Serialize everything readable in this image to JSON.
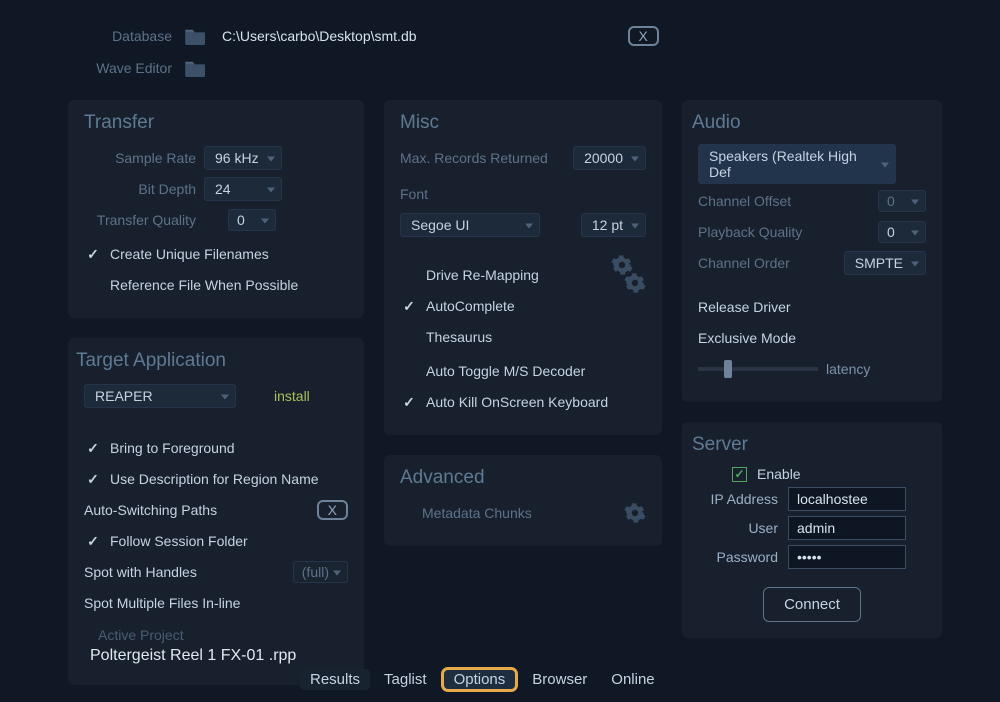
{
  "top": {
    "database_label": "Database",
    "database_path": "C:\\Users\\carbo\\Desktop\\smt.db",
    "wave_editor_label": "Wave Editor",
    "key_x": "X"
  },
  "transfer": {
    "title": "Transfer",
    "sample_rate_label": "Sample Rate",
    "sample_rate": "96 kHz",
    "bit_depth_label": "Bit Depth",
    "bit_depth": "24",
    "quality_label": "Transfer  Quality",
    "quality": "0",
    "create_unique": "Create Unique Filenames",
    "reference_file": "Reference File When Possible"
  },
  "target": {
    "title": "Target Application",
    "app": "REAPER",
    "install": "install",
    "bring_fg": "Bring to Foreground",
    "use_desc": "Use Description for Region Name",
    "auto_switch": "Auto-Switching Paths",
    "auto_switch_key": "X",
    "follow_session": "Follow Session Folder",
    "spot_handles": "Spot with Handles",
    "spot_handles_val": "(full)",
    "spot_multi": "Spot Multiple Files In-line",
    "active_project_label": "Active Project",
    "active_project": "Poltergeist Reel 1 FX-01 .rpp"
  },
  "misc": {
    "title": "Misc",
    "max_records_label": "Max. Records Returned",
    "max_records": "20000",
    "font_label": "Font",
    "font_name": "Segoe UI",
    "font_size": "12 pt",
    "drive_remap": "Drive Re-Mapping",
    "autocomplete": "AutoComplete",
    "thesaurus": "Thesaurus",
    "auto_toggle_ms": "Auto Toggle M/S Decoder",
    "auto_kill_kb": "Auto Kill OnScreen Keyboard"
  },
  "advanced": {
    "title": "Advanced",
    "metadata_chunks": "Metadata Chunks"
  },
  "audio": {
    "title": "Audio",
    "device": "Speakers (Realtek High Def",
    "channel_offset_label": "Channel Offset",
    "channel_offset": "0",
    "playback_quality_label": "Playback Quality",
    "playback_quality": "0",
    "channel_order_label": "Channel Order",
    "channel_order": "SMPTE",
    "release_driver": "Release Driver",
    "exclusive_mode": "Exclusive Mode",
    "latency_label": "latency"
  },
  "server": {
    "title": "Server",
    "enable": "Enable",
    "ip_label": "IP Address",
    "ip": "localhostee",
    "user_label": "User",
    "user": "admin",
    "password_label": "Password",
    "password": "•••••",
    "connect": "Connect"
  },
  "tabs": {
    "results": "Results",
    "taglist": "Taglist",
    "options": "Options",
    "browser": "Browser",
    "online": "Online"
  }
}
